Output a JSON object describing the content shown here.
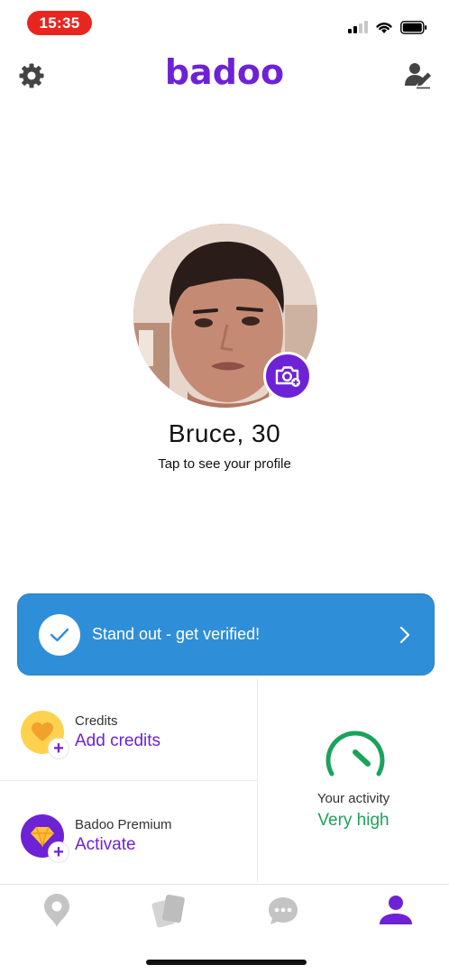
{
  "status_bar": {
    "time": "15:35"
  },
  "header": {
    "logo": "badoo"
  },
  "profile": {
    "name": "Bruce, 30",
    "subtitle": "Tap to see your profile"
  },
  "verify_banner": {
    "text": "Stand out - get verified!"
  },
  "credits": {
    "title": "Credits",
    "action": "Add credits"
  },
  "premium": {
    "title": "Badoo Premium",
    "action": "Activate"
  },
  "activity": {
    "label": "Your activity",
    "value": "Very high",
    "level": "very-high"
  },
  "nav": {
    "items": [
      {
        "icon": "location-pin-icon",
        "active": false
      },
      {
        "icon": "cards-icon",
        "active": false
      },
      {
        "icon": "chat-bubble-icon",
        "active": false
      },
      {
        "icon": "profile-icon",
        "active": true
      }
    ]
  },
  "colors": {
    "brand": "#6e22d6",
    "banner": "#2f8ed8",
    "activity": "#1aa35a",
    "credits": "#ffd24d",
    "status_time_bg": "#e8261f"
  }
}
